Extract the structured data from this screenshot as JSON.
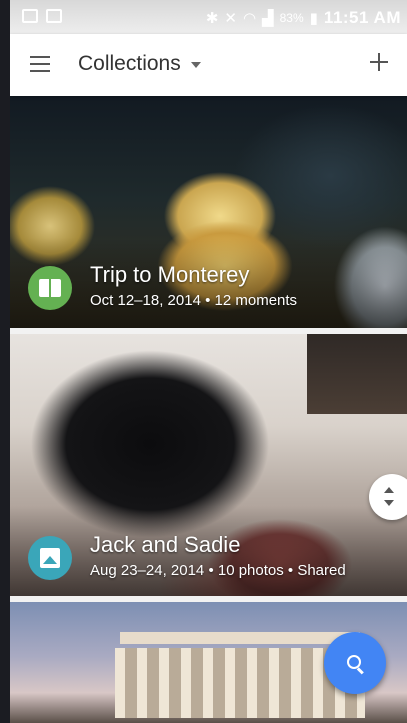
{
  "statusbar": {
    "battery_percent": "83%",
    "time": "11:51 AM",
    "icons": [
      "bluetooth-icon",
      "mute-icon",
      "wifi-icon",
      "signal-icon",
      "battery-icon"
    ]
  },
  "appbar": {
    "title": "Collections",
    "menu_icon": "hamburger-menu-icon",
    "dropdown_icon": "dropdown-caret-icon",
    "add_icon": "plus-icon"
  },
  "collections": [
    {
      "title": "Trip to Monterey",
      "subtitle": "Oct 12–18, 2014 • 12 moments",
      "badge_icon": "story-book-icon",
      "badge_color": "#64b152"
    },
    {
      "title": "Jack and Sadie",
      "subtitle": "Aug 23–24, 2014 • 10 photos • Shared",
      "badge_icon": "album-photo-icon",
      "badge_color": "#3aa6b9"
    },
    {
      "title": "",
      "subtitle": ""
    }
  ],
  "fab": {
    "icon": "search-icon",
    "color": "#4285f4"
  },
  "scroll_handle": {
    "icon": "scroll-updown-icon"
  }
}
